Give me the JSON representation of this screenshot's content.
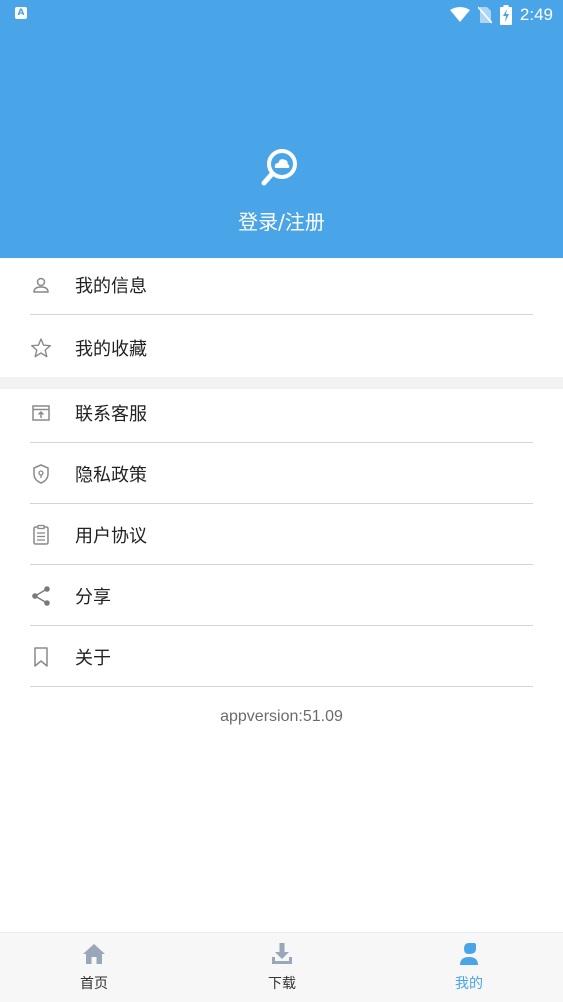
{
  "status_bar": {
    "time": "2:49",
    "app_badge": "A"
  },
  "header": {
    "login_label": "登录/注册"
  },
  "menu": {
    "items": [
      {
        "label": "我的信息",
        "icon": "person-icon"
      },
      {
        "label": "我的收藏",
        "icon": "star-icon"
      },
      {
        "label": "联系客服",
        "icon": "contact-icon"
      },
      {
        "label": "隐私政策",
        "icon": "shield-icon"
      },
      {
        "label": "用户协议",
        "icon": "clipboard-icon"
      },
      {
        "label": "分享",
        "icon": "share-icon"
      },
      {
        "label": "关于",
        "icon": "bookmark-icon"
      }
    ]
  },
  "app_version": "appversion:51.09",
  "bottom_nav": {
    "items": [
      {
        "label": "首页",
        "icon": "home-icon",
        "active": false
      },
      {
        "label": "下载",
        "icon": "download-icon",
        "active": false
      },
      {
        "label": "我的",
        "icon": "profile-icon",
        "active": true
      }
    ]
  },
  "colors": {
    "primary": "#4aa5e8",
    "text": "#222222",
    "icon_gray": "#8a8a8a",
    "nav_icon_inactive": "#9aa7b8"
  }
}
